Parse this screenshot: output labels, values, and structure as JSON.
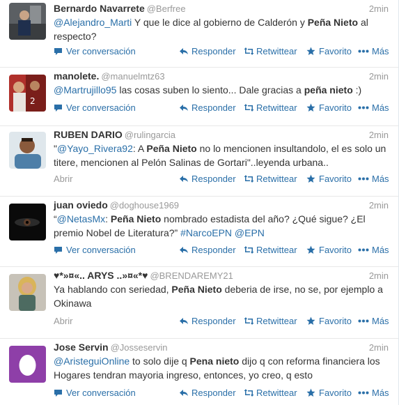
{
  "tweets": [
    {
      "fullname": "Bernardo Navarrete",
      "username": "@Berfree",
      "time": "2min",
      "text_parts": [
        {
          "t": "link",
          "v": "@Alejandro_Marti"
        },
        {
          "t": "plain",
          "v": " Y que le dice al gobierno de Calderón y "
        },
        {
          "t": "bold",
          "v": "Peña Nieto"
        },
        {
          "t": "plain",
          "v": " al respecto?"
        }
      ],
      "expand_label": "Ver conversación"
    },
    {
      "fullname": "manolete.",
      "username": "@manuelmtz63",
      "time": "2min",
      "text_parts": [
        {
          "t": "link",
          "v": "@Martrujillo95"
        },
        {
          "t": "plain",
          "v": " las cosas suben lo siento... Dale gracias a "
        },
        {
          "t": "bold",
          "v": "peña nieto"
        },
        {
          "t": "plain",
          "v": " :)"
        }
      ],
      "expand_label": "Ver conversación"
    },
    {
      "fullname": "RUBEN DARIO",
      "username": "@rulingarcia",
      "time": "2min",
      "text_parts": [
        {
          "t": "plain",
          "v": "\""
        },
        {
          "t": "link",
          "v": "@Yayo_Rivera92"
        },
        {
          "t": "plain",
          "v": ": A "
        },
        {
          "t": "bold",
          "v": "Peña Nieto"
        },
        {
          "t": "plain",
          "v": " no lo mencionen insultandolo, el es solo un titere, mencionen al Pelón Salinas de Gortari\"..leyenda urbana.."
        }
      ],
      "expand_label": "Abrir"
    },
    {
      "fullname": "juan oviedo",
      "username": "@doghouse1969",
      "time": "2min",
      "text_parts": [
        {
          "t": "plain",
          "v": "“"
        },
        {
          "t": "link",
          "v": "@NetasMx"
        },
        {
          "t": "plain",
          "v": ": "
        },
        {
          "t": "bold",
          "v": "Peña Nieto"
        },
        {
          "t": "plain",
          "v": " nombrado estadista del año? ¿Qué sigue? ¿El premio Nobel de Literatura?” "
        },
        {
          "t": "link",
          "v": "#NarcoEPN"
        },
        {
          "t": "plain",
          "v": " "
        },
        {
          "t": "link",
          "v": "@EPN"
        }
      ],
      "expand_label": "Ver conversación"
    },
    {
      "fullname": "♥*»¤«.. ARYS ..»¤«*♥",
      "username": "@BRENDAREMY21",
      "time": "2min",
      "text_parts": [
        {
          "t": "plain",
          "v": "Ya hablando con seriedad, "
        },
        {
          "t": "bold",
          "v": "Peña Nieto"
        },
        {
          "t": "plain",
          "v": " deberia de irse, no se, por ejemplo a Okinawa"
        }
      ],
      "expand_label": "Abrir"
    },
    {
      "fullname": "Jose Servin",
      "username": "@Josseservin",
      "time": "2min",
      "text_parts": [
        {
          "t": "link",
          "v": "@AristeguiOnline"
        },
        {
          "t": "plain",
          "v": " to solo dije q "
        },
        {
          "t": "bold",
          "v": "Pena nieto"
        },
        {
          "t": "plain",
          "v": " dijo q con reforma financiera los Hogares  tendran mayoria ingreso, entonces, yo creo, q esto"
        }
      ],
      "expand_label": "Ver conversación"
    }
  ],
  "actions": {
    "reply": "Responder",
    "retweet": "Retwittear",
    "favorite": "Favorito",
    "more": "Más"
  },
  "colors": {
    "link": "#2a6fa8",
    "muted": "#999999",
    "divider": "#e8e8e8"
  },
  "icons": {
    "conversation": "speech-bubble-icon",
    "reply": "reply-arrow-icon",
    "retweet": "retweet-arrows-icon",
    "favorite": "star-icon",
    "more": "ellipsis-icon"
  }
}
